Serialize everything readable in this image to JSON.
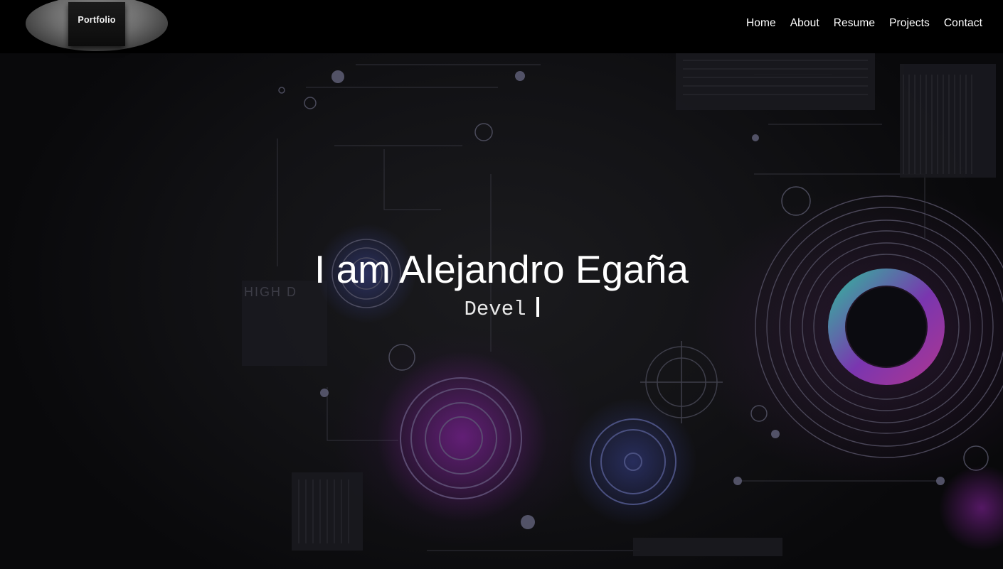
{
  "header": {
    "logo_text": "Portfolio",
    "nav": [
      "Home",
      "About",
      "Resume",
      "Projects",
      "Contact"
    ]
  },
  "hero": {
    "title": "I am Alejandro Egaña",
    "subtitle": "Devel",
    "background_text": "HIGH D"
  },
  "colors": {
    "header_bg": "#000000",
    "page_bg": "#0c0c0e",
    "text": "#ffffff",
    "accent_purple": "#b02bd0",
    "accent_teal": "#3cc8b4",
    "accent_blue": "#6070e0"
  }
}
